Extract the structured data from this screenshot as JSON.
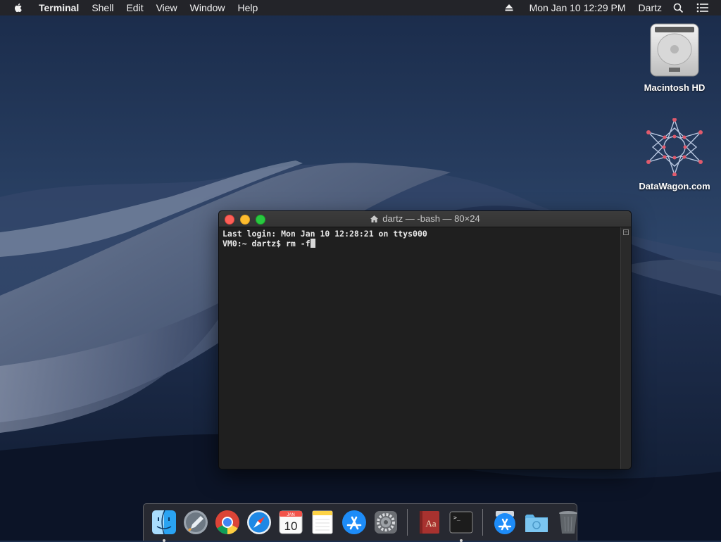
{
  "menubar": {
    "app_name": "Terminal",
    "menus": [
      "Shell",
      "Edit",
      "View",
      "Window",
      "Help"
    ],
    "clock": "Mon Jan 10  12:29 PM",
    "user": "Dartz"
  },
  "desktop": {
    "icons": [
      {
        "label": "Macintosh HD",
        "icon": "hard-drive-icon"
      },
      {
        "label": "DataWagon.com",
        "icon": "star-network-icon"
      }
    ]
  },
  "terminal": {
    "title": "dartz — -bash — 80×24",
    "lines": [
      "Last login: Mon Jan 10 12:28:21 on ttys000",
      "VM0:~ dartz$ rm -f"
    ]
  },
  "dock": {
    "apps": [
      {
        "name": "Finder",
        "icon": "finder-icon",
        "running": true
      },
      {
        "name": "Launchpad",
        "icon": "launchpad-icon",
        "running": false
      },
      {
        "name": "Google Chrome",
        "icon": "chrome-icon",
        "running": false
      },
      {
        "name": "Safari",
        "icon": "safari-icon",
        "running": false
      },
      {
        "name": "Calendar",
        "icon": "calendar-icon",
        "running": false,
        "month": "JAN",
        "day": "10"
      },
      {
        "name": "Notes",
        "icon": "notes-icon",
        "running": false
      },
      {
        "name": "App Store",
        "icon": "app-store-icon",
        "running": false
      },
      {
        "name": "System Preferences",
        "icon": "gear-icon",
        "running": false
      },
      {
        "name": "Dictionary",
        "icon": "dictionary-icon",
        "running": false,
        "glyph": "Aa"
      },
      {
        "name": "Terminal",
        "icon": "terminal-icon",
        "running": true,
        "glyph": ">_"
      },
      {
        "name": "App Store Downloads",
        "icon": "app-store-icon",
        "running": false
      },
      {
        "name": "Documents Folder",
        "icon": "folder-icon",
        "running": false
      },
      {
        "name": "Trash",
        "icon": "trash-icon",
        "running": false
      }
    ]
  },
  "colors": {
    "close": "#fe5f57",
    "minimize": "#febc2e",
    "maximize": "#28c840",
    "terminal_bg": "#1f1f1f",
    "terminal_text": "#e8e8e8"
  }
}
